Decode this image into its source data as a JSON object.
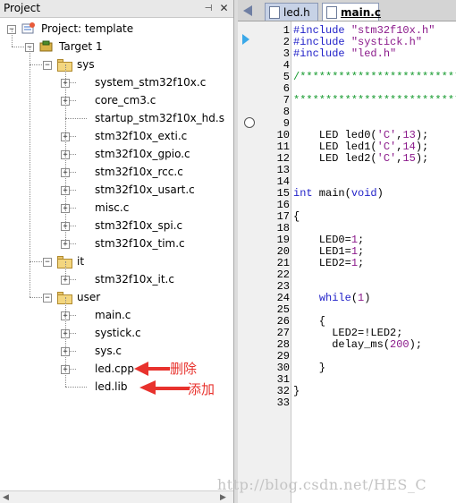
{
  "panel": {
    "title": "Project",
    "pin_icon": "pin-icon",
    "close_icon": "close-icon"
  },
  "tree": {
    "project": "Project: template",
    "target": "Target 1",
    "groups": [
      {
        "name": "sys",
        "files": [
          "system_stm32f10x.c",
          "core_cm3.c",
          "startup_stm32f10x_hd.s",
          "stm32f10x_exti.c",
          "stm32f10x_gpio.c",
          "stm32f10x_rcc.c",
          "stm32f10x_usart.c",
          "misc.c",
          "stm32f10x_spi.c",
          "stm32f10x_tim.c"
        ]
      },
      {
        "name": "it",
        "files": [
          "stm32f10x_it.c"
        ]
      },
      {
        "name": "user",
        "files": [
          "main.c",
          "systick.c",
          "sys.c",
          "led.cpp",
          "led.lib"
        ]
      }
    ]
  },
  "annotations": {
    "delete": "删除",
    "add": "添加",
    "color": "#e8322d"
  },
  "editor": {
    "tabs": [
      {
        "label": "led.h",
        "active": false
      },
      {
        "label": "main.c",
        "active": true
      }
    ],
    "line_numbers": [
      "1",
      "2",
      "3",
      "4",
      "5",
      "6",
      "7",
      "8",
      "9",
      "10",
      "11",
      "12",
      "13",
      "14",
      "15",
      "16",
      "17",
      "18",
      "19",
      "20",
      "21",
      "22",
      "23",
      "24",
      "25",
      "26",
      "27",
      "28",
      "29",
      "30",
      "31",
      "32",
      "33"
    ],
    "lines": [
      "#include \"stm32f10x.h\"",
      "#include \"systick.h\"",
      "#include \"led.h\"",
      "",
      "/*************************************",
      "",
      "**************************************",
      "",
      "",
      "    LED led0('C',13);",
      "    LED led1('C',14);",
      "    LED led2('C',15);",
      "",
      "",
      "int main(void)",
      "",
      "{",
      "",
      "    LED0=1;",
      "    LED1=1;",
      "    LED2=1;",
      "",
      "",
      "    while(1)",
      "",
      "    {",
      "      LED2=!LED2;",
      "      delay_ms(200);",
      "",
      "    }",
      "",
      "}",
      ""
    ]
  },
  "watermark": "http://blog.csdn.net/HES_C",
  "colors": {
    "preprocessor": "#1f1fc8",
    "string": "#8b1a8b",
    "comment": "#159a2e",
    "keyword": "#1f1fc8",
    "number": "#8b1a8b"
  }
}
